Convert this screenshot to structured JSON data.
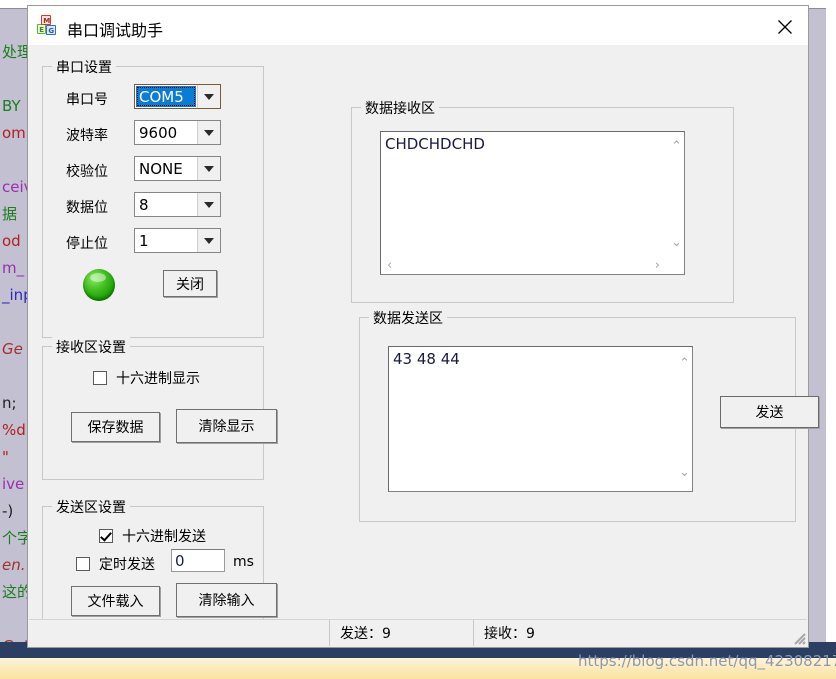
{
  "background": {
    "code_lines": [
      {
        "text": "处理",
        "color": "green"
      },
      {
        "text": "",
        "color": "dark"
      },
      {
        "text": "BY",
        "color": "green"
      },
      {
        "text": "omm",
        "color": "red"
      },
      {
        "text": "",
        "color": "dark"
      },
      {
        "text": "ceiv",
        "color": "purple"
      },
      {
        "text": "据",
        "color": "green"
      },
      {
        "text": "od",
        "color": "red"
      },
      {
        "text": "m_",
        "color": "purple"
      },
      {
        "text": "_inp",
        "color": "blue"
      },
      {
        "text": "",
        "color": "dark"
      },
      {
        "text": "Ge",
        "color": "ital"
      },
      {
        "text": "",
        "color": "dark"
      },
      {
        "text": "n;",
        "color": "dark"
      },
      {
        "text": "%d\"",
        "color": "red"
      },
      {
        "text": "\"",
        "color": "red"
      },
      {
        "text": "ive",
        "color": "purple"
      },
      {
        "text": "-)",
        "color": "dark"
      },
      {
        "text": "个字",
        "color": "green"
      },
      {
        "text": "en.",
        "color": "ital"
      },
      {
        "text": "这的",
        "color": "green"
      },
      {
        "text": "",
        "color": "dark"
      },
      {
        "text": "Getu",
        "color": "ital"
      }
    ],
    "watermark": "https://blog.csdn.net/qq_42308217"
  },
  "window": {
    "title": "串口调试助手",
    "icon": "app-icon",
    "close_label": "✕"
  },
  "serial_settings": {
    "legend": "串口设置",
    "fields": [
      {
        "label": "串口号",
        "value": "COM5",
        "focused": true
      },
      {
        "label": "波特率",
        "value": "9600",
        "focused": false
      },
      {
        "label": "校验位",
        "value": "NONE",
        "focused": false
      },
      {
        "label": "数据位",
        "value": "8",
        "focused": false
      },
      {
        "label": "停止位",
        "value": "1",
        "focused": false
      }
    ],
    "led_state": "on",
    "led_color": "#2db313",
    "close_port_button": "关闭"
  },
  "receive_settings": {
    "legend": "接收区设置",
    "hex_display": {
      "label": "十六进制显示",
      "checked": false
    },
    "save_button": "保存数据",
    "clear_button": "清除显示"
  },
  "send_settings": {
    "legend": "发送区设置",
    "hex_send": {
      "label": "十六进制发送",
      "checked": true
    },
    "timed_send": {
      "label": "定时发送",
      "checked": false,
      "interval": "0",
      "unit": "ms"
    },
    "load_file_button": "文件载入",
    "clear_input_button": "清除输入"
  },
  "receive_area": {
    "legend": "数据接收区",
    "content": "CHDCHDCHD"
  },
  "send_area": {
    "legend": "数据发送区",
    "content": "43 48 44",
    "send_button": "发送"
  },
  "statusbar": {
    "spacer": "",
    "sent": "发送：9",
    "received": "接收：9"
  }
}
